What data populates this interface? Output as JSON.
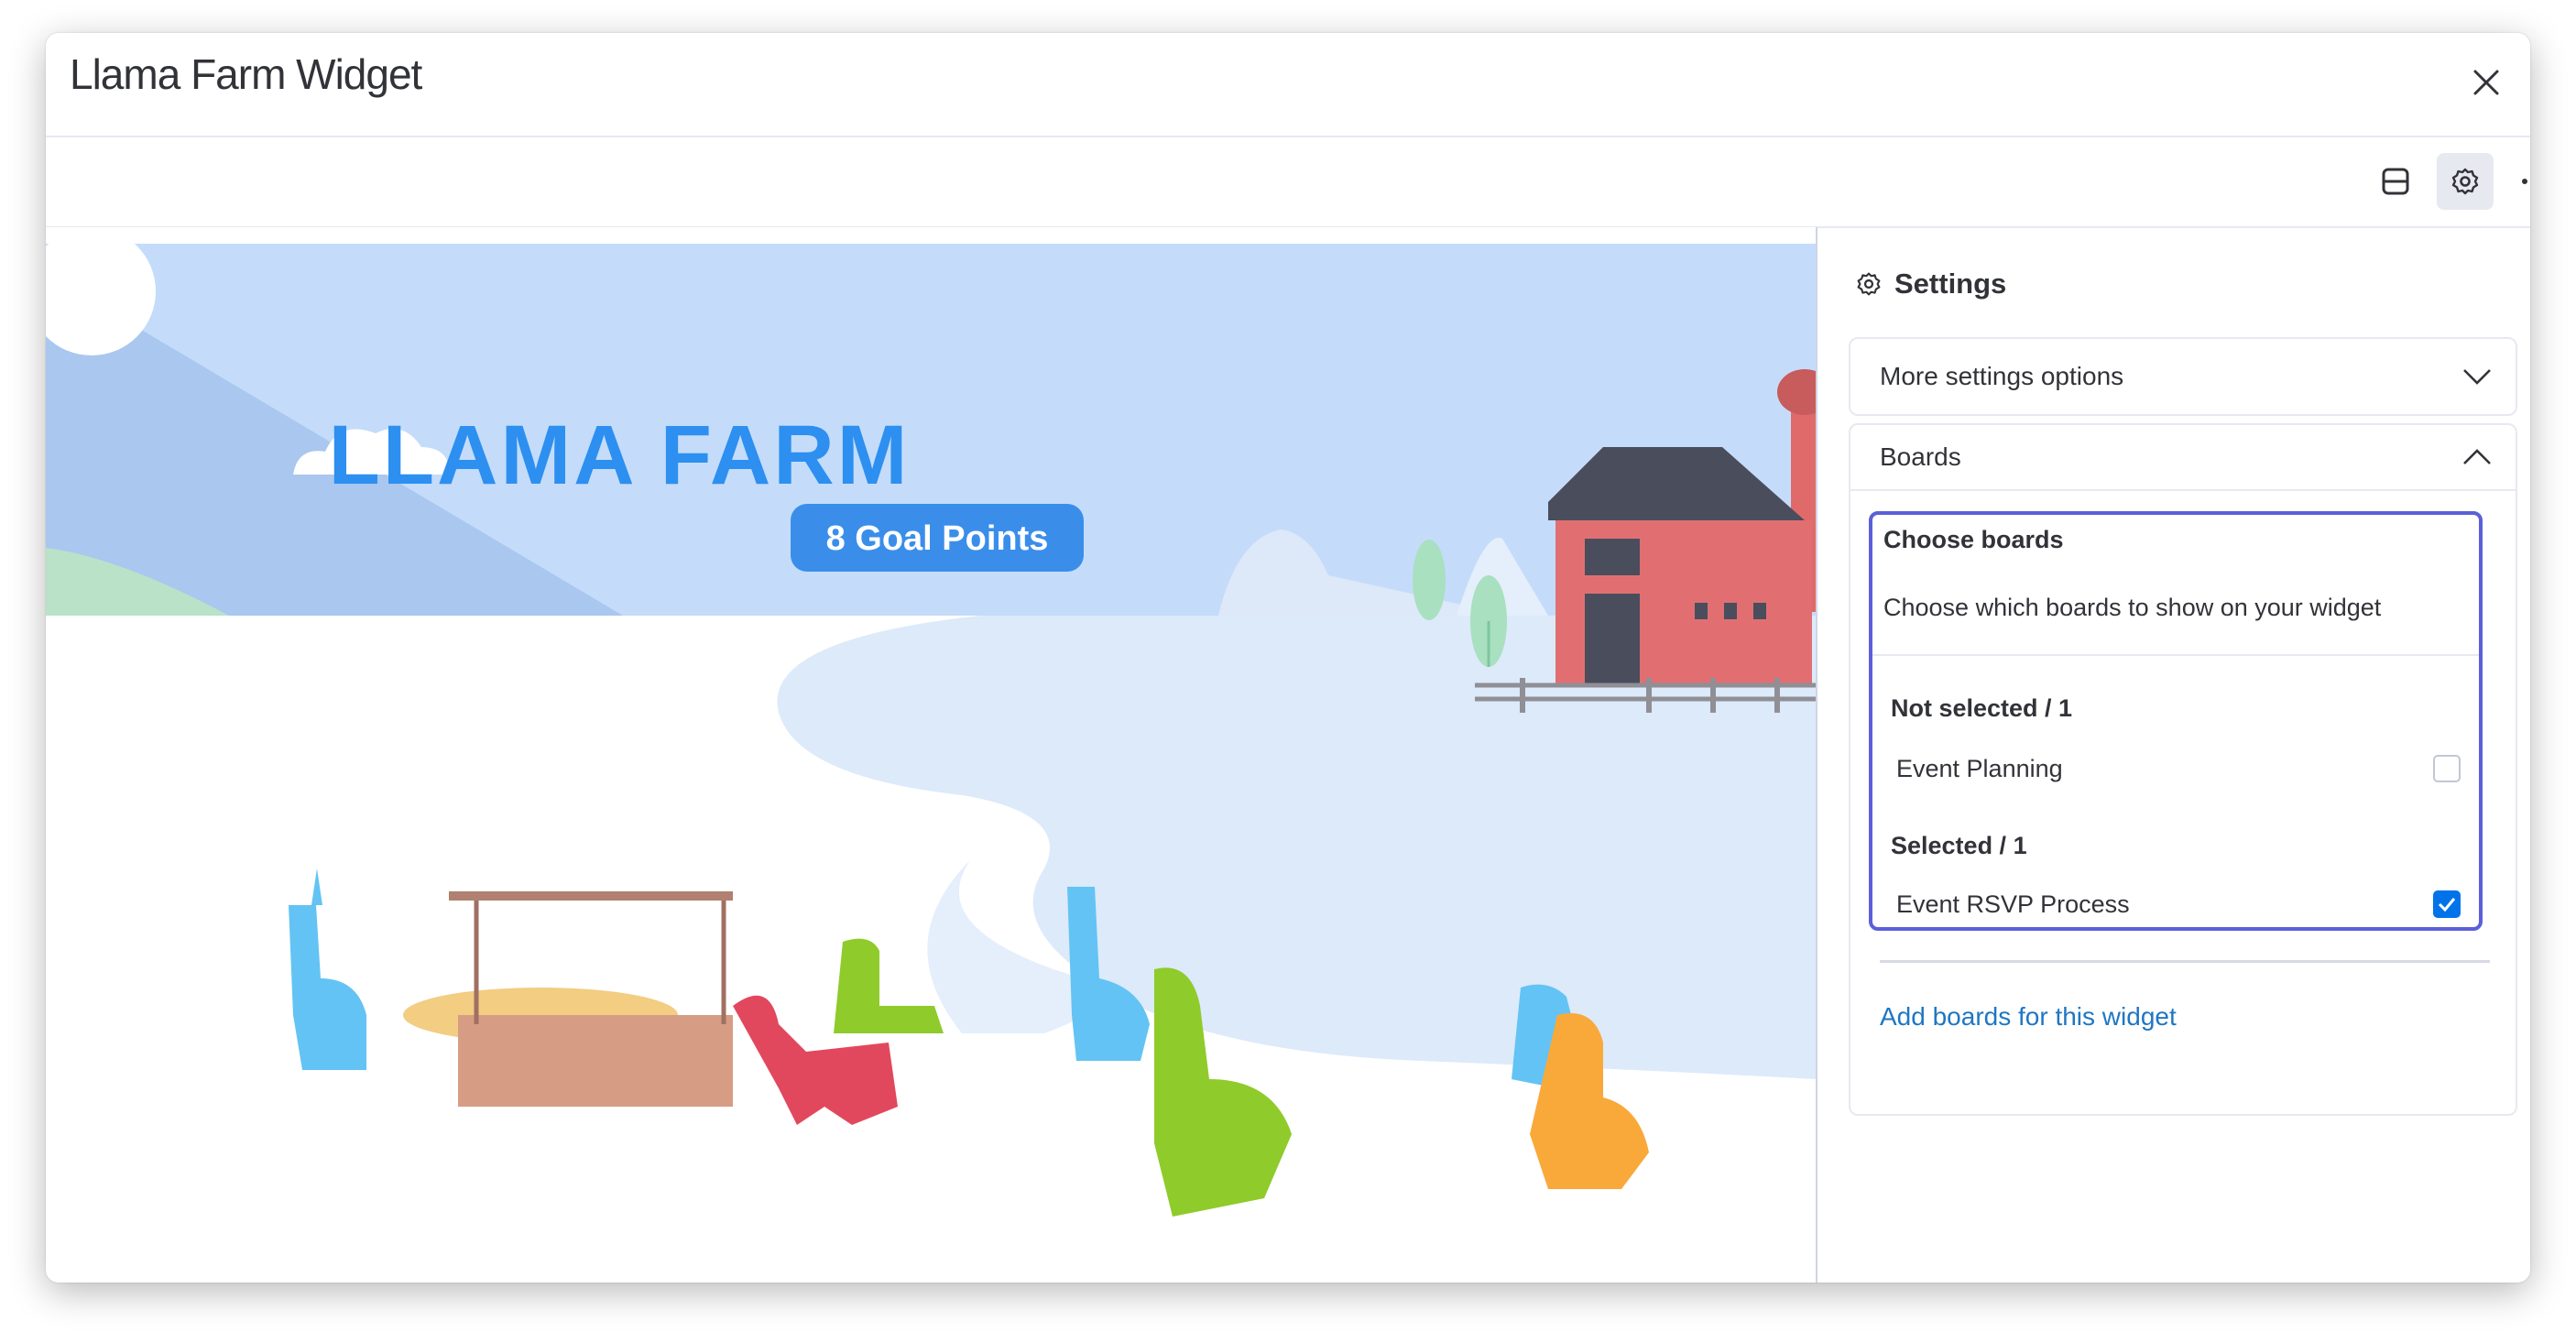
{
  "window": {
    "title": "Llama Farm Widget",
    "close_icon": "close-icon"
  },
  "toolbar": {
    "icons": [
      "layout-icon",
      "gear-icon",
      "more-icon"
    ]
  },
  "widget": {
    "title": "LLAMA FARM",
    "goal_text": "8 Goal Points"
  },
  "settings": {
    "title": "Settings",
    "more_label": "More settings options",
    "boards_label": "Boards",
    "choose_title": "Choose boards",
    "choose_desc": "Choose which boards to show on your widget",
    "not_selected_header": "Not selected / 1",
    "selected_header": "Selected / 1",
    "boards": [
      {
        "name": "Event Planning",
        "selected": false
      },
      {
        "name": "Event RSVP Process",
        "selected": true
      }
    ],
    "add_link": "Add boards for this widget"
  },
  "colors": {
    "accent": "#0073ea",
    "highlight": "#5b5fd9",
    "link": "#1f76c2",
    "sky": "#c4dcfa",
    "title_blue": "#2d8ff0"
  }
}
